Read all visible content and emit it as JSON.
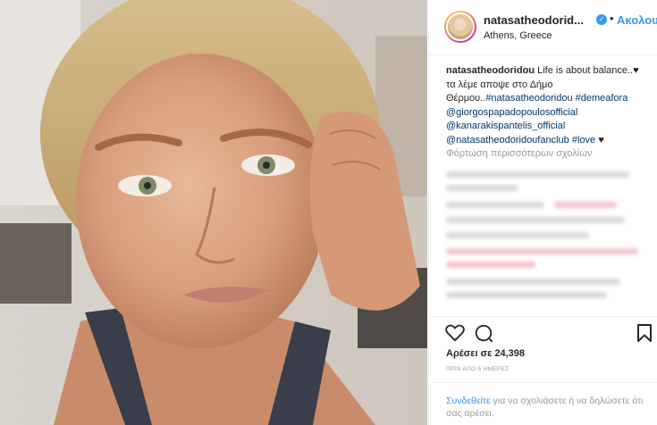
{
  "post": {
    "username": "natasatheodorid...",
    "verified_icon": "verified-badge-icon",
    "follow_label": "Ακολουθήστε",
    "location": "Athens, Greece",
    "caption": {
      "username": "natasatheodoridou",
      "text_1": "Life is about balance..♥",
      "text_2": "τα λέμε αποψε στο Δήμο",
      "text_3": "Θέρμου..",
      "tags": [
        "#natasatheodoridou",
        "#demeafora",
        "@giorgospapadopoulosofficial",
        "@kanarakispantelis_official",
        "@natasatheodoridoufanclub",
        "#love"
      ],
      "heart": "♥"
    },
    "load_more_label": "Φόρτωση περισσότερων σχολίων",
    "likes": "Αρέσει σε 24,398",
    "date": "ΠΡΙΝ ΑΠΟ 5 ΗΜΕΡΕΣ",
    "login": {
      "link": "Συνδεθείτε",
      "text": "για να σχολιάσετε ή να δηλώσετε ότι σας αρέσει."
    },
    "icons": {
      "like": "heart-icon",
      "comment": "comment-icon",
      "save": "bookmark-icon"
    },
    "colors": {
      "link_blue": "#3897f0",
      "tag_blue": "#003569",
      "muted": "#999999"
    }
  }
}
